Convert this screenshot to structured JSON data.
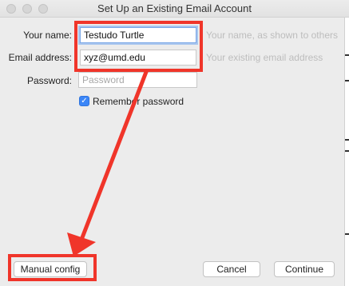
{
  "window": {
    "title": "Set Up an Existing Email Account"
  },
  "form": {
    "name_label": "Your name:",
    "name_value": "Testudo Turtle",
    "name_hint": "Your name, as shown to others",
    "email_label": "Email address:",
    "email_value": "xyz@umd.edu",
    "email_hint": "Your existing email address",
    "password_label": "Password:",
    "password_placeholder": "Password",
    "remember_label": "Remember password",
    "remember_checked": true
  },
  "buttons": {
    "manual_config": "Manual config",
    "cancel": "Cancel",
    "continue": "Continue"
  },
  "annotations": {
    "highlight_color": "#f0352a"
  }
}
